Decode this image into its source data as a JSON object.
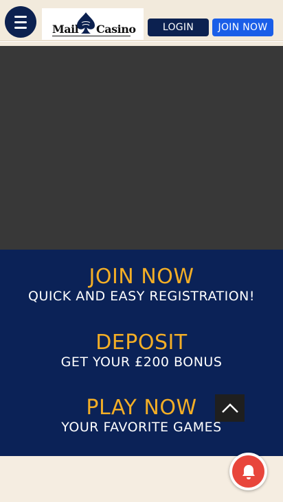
{
  "header": {
    "logo_left": "Mail",
    "logo_right": "Casino",
    "login_label": "LOGIN",
    "join_label": "JOIN NOW"
  },
  "steps": [
    {
      "title": "JOIN NOW",
      "subtitle": "QUICK AND EASY REGISTRATION!"
    },
    {
      "title": "DEPOSIT",
      "subtitle": "GET YOUR £200 BONUS"
    },
    {
      "title": "PLAY NOW",
      "subtitle": "YOUR FAVORITE GAMES"
    }
  ],
  "icons": {
    "menu": "hamburger-icon",
    "scroll_top": "chevron-up-icon",
    "notification": "bell-icon"
  },
  "colors": {
    "navy": "#0c2150",
    "steps_background": "#0b2257",
    "gold": "#f3ae26",
    "join_button": "#1a5ee8",
    "video_placeholder": "#383838",
    "notification": "#e8463c"
  }
}
